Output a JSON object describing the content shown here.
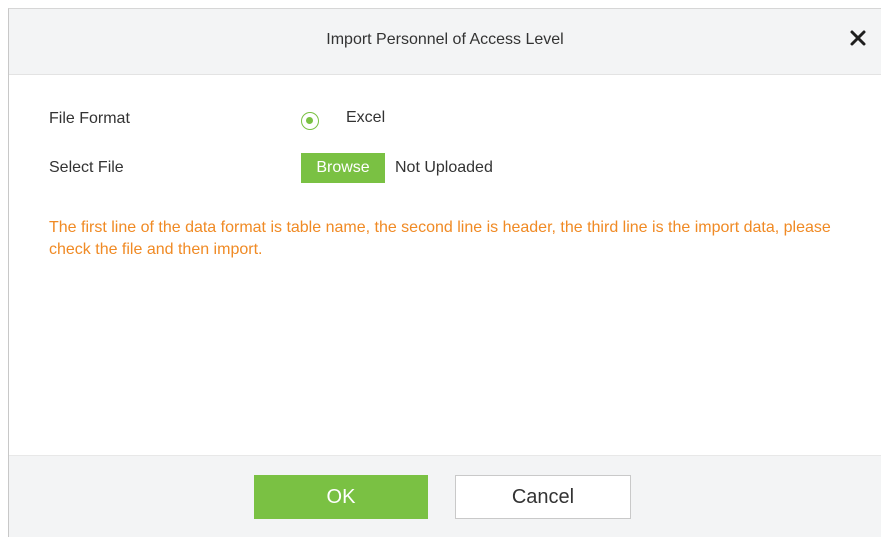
{
  "dialog": {
    "title": "Import Personnel of Access Level",
    "close_icon": "close-icon"
  },
  "form": {
    "file_format_label": "File Format",
    "file_format_option": "Excel",
    "file_format_selected": true,
    "select_file_label": "Select File",
    "browse_label": "Browse",
    "upload_status": "Not Uploaded"
  },
  "note": "The first line of the data format is table name, the second line is header, the third line is the import data, please check the file and then import.",
  "footer": {
    "ok_label": "OK",
    "cancel_label": "Cancel"
  },
  "colors": {
    "accent": "#7ac143",
    "note_text": "#f08a24",
    "header_bg": "#f3f4f5"
  }
}
